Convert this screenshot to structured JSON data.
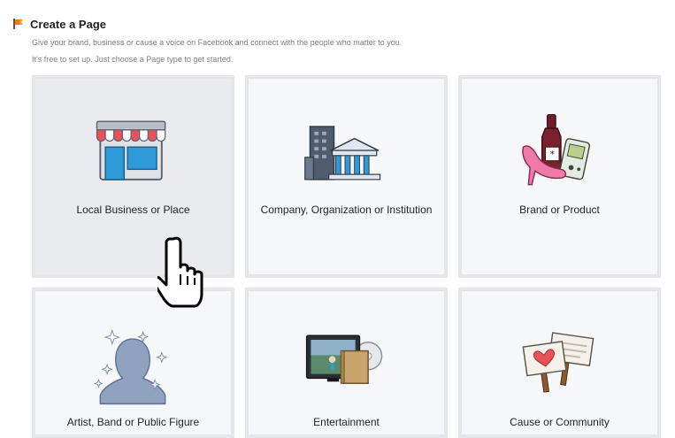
{
  "header": {
    "title": "Create a Page",
    "intro_line1": "Give your brand, business or cause a voice on Facebook and connect with the people who matter to you.",
    "intro_line2": "It's free to set up. Just choose a Page type to get started."
  },
  "tiles": [
    {
      "label": "Local Business or Place",
      "icon": "storefront-icon"
    },
    {
      "label": "Company, Organization or Institution",
      "icon": "buildings-icon"
    },
    {
      "label": "Brand or Product",
      "icon": "products-icon"
    },
    {
      "label": "Artist, Band or Public Figure",
      "icon": "person-silhouette-icon"
    },
    {
      "label": "Entertainment",
      "icon": "tv-media-icon"
    },
    {
      "label": "Cause or Community",
      "icon": "signs-icon"
    }
  ],
  "colors": {
    "tile_bg": "#f6f7f9",
    "tile_border": "#e4e6ea",
    "tile_hover_bg": "#e9ebee",
    "intro_text": "#7f7f7f",
    "awning_red": "#e8525b",
    "window_blue": "#2e9ad8"
  }
}
